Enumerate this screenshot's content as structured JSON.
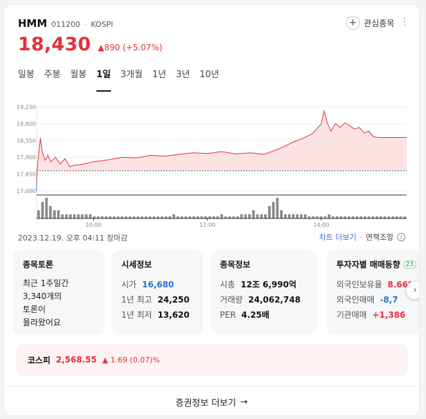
{
  "stock": {
    "name": "HMM",
    "code": "011200",
    "separator": "·",
    "exchange": "KOSPI",
    "watch_label": "관심종목",
    "price": "18,430",
    "change": "▲890",
    "change_pct": "(+5.07%)"
  },
  "tabs": [
    "일봉",
    "주봉",
    "월봉",
    "1일",
    "3개월",
    "1년",
    "3년",
    "10년"
  ],
  "active_tab": "1일",
  "chart_data": {
    "type": "area",
    "y_ticks": [
      "19,250",
      "18,800",
      "18,350",
      "17,900",
      "17,450",
      "17,000"
    ],
    "y_tick_values": [
      19250,
      18800,
      18350,
      17900,
      17450,
      17000
    ],
    "x_ticks": [
      "10:00",
      "12:00",
      "14:00"
    ],
    "previous_close": 17540,
    "ylim": [
      17000,
      19250
    ],
    "session_start": "09:00",
    "session_end": "15:30",
    "price_series": [
      {
        "t": "09:00",
        "v": 17220
      },
      {
        "t": "09:01",
        "v": 17700
      },
      {
        "t": "09:03",
        "v": 18150
      },
      {
        "t": "09:04",
        "v": 18420
      },
      {
        "t": "09:06",
        "v": 18050
      },
      {
        "t": "09:09",
        "v": 17820
      },
      {
        "t": "09:12",
        "v": 17950
      },
      {
        "t": "09:15",
        "v": 17780
      },
      {
        "t": "09:20",
        "v": 17900
      },
      {
        "t": "09:25",
        "v": 17720
      },
      {
        "t": "09:30",
        "v": 17860
      },
      {
        "t": "09:35",
        "v": 17650
      },
      {
        "t": "09:40",
        "v": 17690
      },
      {
        "t": "09:50",
        "v": 17720
      },
      {
        "t": "10:00",
        "v": 17780
      },
      {
        "t": "10:15",
        "v": 17830
      },
      {
        "t": "10:30",
        "v": 17900
      },
      {
        "t": "10:45",
        "v": 17880
      },
      {
        "t": "11:00",
        "v": 17950
      },
      {
        "t": "11:15",
        "v": 17930
      },
      {
        "t": "11:30",
        "v": 17980
      },
      {
        "t": "11:45",
        "v": 18020
      },
      {
        "t": "12:00",
        "v": 18000
      },
      {
        "t": "12:15",
        "v": 18050
      },
      {
        "t": "12:30",
        "v": 17990
      },
      {
        "t": "12:45",
        "v": 18020
      },
      {
        "t": "13:00",
        "v": 17980
      },
      {
        "t": "13:15",
        "v": 18120
      },
      {
        "t": "13:30",
        "v": 18300
      },
      {
        "t": "13:40",
        "v": 18400
      },
      {
        "t": "13:50",
        "v": 18520
      },
      {
        "t": "13:55",
        "v": 18650
      },
      {
        "t": "14:00",
        "v": 18800
      },
      {
        "t": "14:03",
        "v": 19150
      },
      {
        "t": "14:06",
        "v": 18850
      },
      {
        "t": "14:10",
        "v": 18600
      },
      {
        "t": "14:15",
        "v": 18800
      },
      {
        "t": "14:20",
        "v": 18700
      },
      {
        "t": "14:25",
        "v": 18820
      },
      {
        "t": "14:30",
        "v": 18750
      },
      {
        "t": "14:35",
        "v": 18650
      },
      {
        "t": "14:40",
        "v": 18700
      },
      {
        "t": "14:45",
        "v": 18550
      },
      {
        "t": "14:50",
        "v": 18600
      },
      {
        "t": "14:55",
        "v": 18450
      },
      {
        "t": "15:00",
        "v": 18430
      },
      {
        "t": "15:30",
        "v": 18430
      }
    ],
    "volume_series": [
      2,
      4,
      5,
      3,
      2,
      2,
      1,
      1,
      1,
      1,
      1,
      1,
      1,
      1,
      0.5,
      0.5,
      0.5,
      0.5,
      0.5,
      0.5,
      0.5,
      0.5,
      0.5,
      0.5,
      0.5,
      0.5,
      0.5,
      0.5,
      0.5,
      0.5,
      0.5,
      0.5,
      0.5,
      0.5,
      1,
      0.5,
      0.5,
      0.5,
      0.5,
      0.5,
      0.5,
      0.5,
      0.5,
      0.5,
      0.5,
      0.5,
      1,
      0.5,
      0.5,
      0.5,
      0.5,
      1,
      1,
      1,
      2,
      1,
      1,
      1,
      3,
      4,
      5,
      2,
      1,
      1,
      1,
      1,
      1,
      1,
      0.5,
      0.5,
      0.5,
      0.5,
      0.5,
      1,
      0.5,
      0.5,
      0.5,
      0.5,
      0.5,
      0.5,
      0.5,
      0.5,
      0.5,
      0.5,
      0.5,
      0.5,
      0.5,
      0.5,
      0.5,
      0.5,
      0.5,
      0.5,
      0.5
    ]
  },
  "meta": {
    "timestamp": "2023.12.19. 오후 04:11 장마감",
    "chart_link": "차트 더보기",
    "separator": "·",
    "disclaimer": "면책조항",
    "info_glyph": "i"
  },
  "cards": {
    "discussion": {
      "title": "종목토론",
      "lines": [
        "최근 1주일간",
        "3,340개의",
        "토론이",
        "올라왔어요"
      ]
    },
    "market": {
      "title": "시세정보",
      "rows": [
        {
          "k": "시가",
          "v": "16,680"
        },
        {
          "k": "1년 최고",
          "v": "24,250"
        },
        {
          "k": "1년 최저",
          "v": "13,620"
        }
      ]
    },
    "info": {
      "title": "종목정보",
      "rows": [
        {
          "k": "시총",
          "v": "12조 6,990억"
        },
        {
          "k": "거래량",
          "v": "24,062,748"
        },
        {
          "k": "PER",
          "v": "4.25배"
        }
      ]
    },
    "investor": {
      "title": "투자자별 매매동향",
      "badge": "23",
      "rows": [
        {
          "k": "외국인보유율",
          "v": "8.66%"
        },
        {
          "k": "외국인매매",
          "v": "-8,7"
        },
        {
          "k": "기관매매",
          "v": "+1,386"
        }
      ]
    },
    "next_glyph": "›"
  },
  "kospi": {
    "label": "코스피",
    "value": "2,568.55",
    "change": "▲ 1.69 (0.07)%"
  },
  "footer": {
    "label": "증권정보 더보기",
    "arrow": "→"
  },
  "colors": {
    "up": "#e5303c",
    "down": "#2f6fd6",
    "area_fill": "#fbe3e4"
  }
}
